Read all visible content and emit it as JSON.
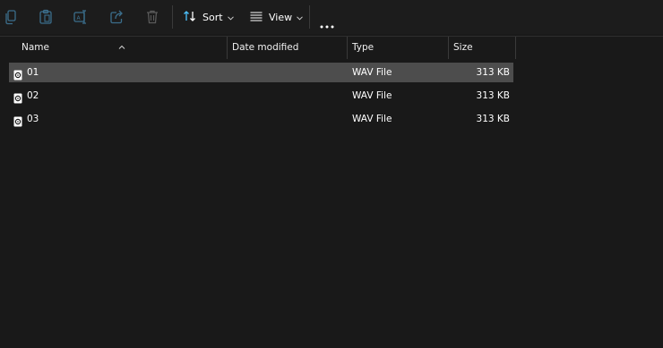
{
  "toolbar": {
    "sort_label": "Sort",
    "view_label": "View",
    "icons": [
      "copy-icon",
      "paste-icon",
      "rename-icon",
      "share-icon",
      "delete-icon",
      "sort-icon",
      "view-icon",
      "more-icon"
    ]
  },
  "columns": {
    "name": "Name",
    "date_modified": "Date modified",
    "type": "Type",
    "size": "Size"
  },
  "files": [
    {
      "name": "01",
      "date_modified": "",
      "type": "WAV File",
      "size": "313 KB",
      "selected": true
    },
    {
      "name": "02",
      "date_modified": "",
      "type": "WAV File",
      "size": "313 KB",
      "selected": false
    },
    {
      "name": "03",
      "date_modified": "",
      "type": "WAV File",
      "size": "313 KB",
      "selected": false
    }
  ],
  "colors": {
    "background": "#191919",
    "selected_row": "#4d4d4d",
    "accent": "#4cc2ff",
    "disabled_icon": "#3b6e8c"
  }
}
